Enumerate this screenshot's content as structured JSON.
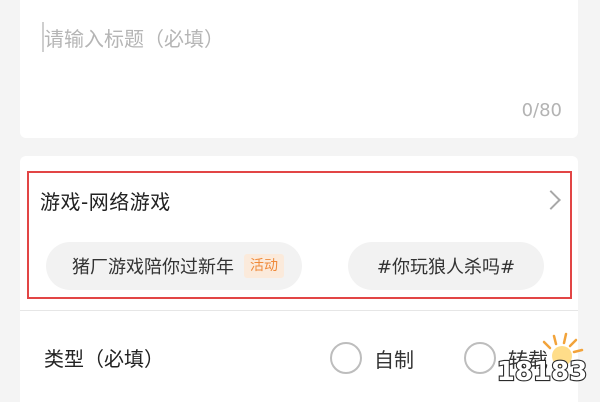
{
  "title_field": {
    "placeholder": "请输入标题（必填）",
    "value": "",
    "counter": "0/80"
  },
  "category": {
    "label": "游戏-网络游戏"
  },
  "tags": [
    {
      "label": "猪厂游戏陪你过新年",
      "badge": "活动",
      "badge_color": "#ef8a3b"
    },
    {
      "label": "#你玩狼人杀吗#"
    }
  ],
  "type_field": {
    "label": "类型（必填）",
    "options": [
      "自制",
      "转载"
    ],
    "selected": null
  },
  "watermark": {
    "text": "18183"
  },
  "colors": {
    "highlight_border": "#e24545",
    "badge_bg": "#fbeadb",
    "badge_text": "#ef8a3b"
  }
}
